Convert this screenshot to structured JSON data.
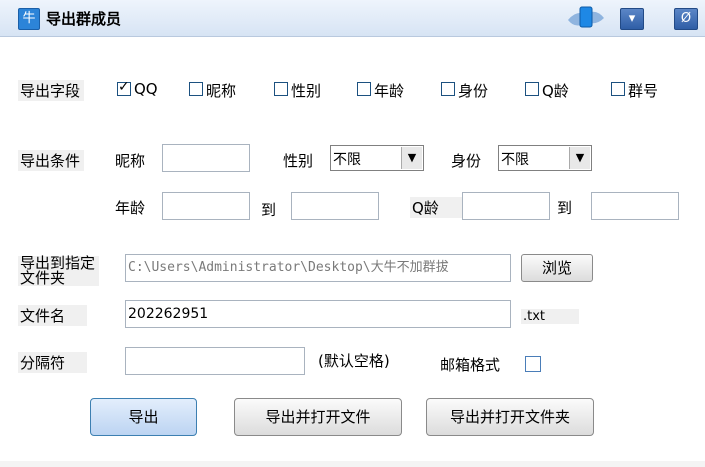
{
  "window": {
    "title": "导出群成员",
    "app_icon_glyph": "牛"
  },
  "titlebar_buttons": {
    "minimize_glyph": "▾",
    "close_glyph": "Ø"
  },
  "fields": {
    "label": "导出字段",
    "options": [
      {
        "label": "QQ",
        "checked": true
      },
      {
        "label": "昵称",
        "checked": false
      },
      {
        "label": "性别",
        "checked": false
      },
      {
        "label": "年龄",
        "checked": false
      },
      {
        "label": "身份",
        "checked": false
      },
      {
        "label": "Q龄",
        "checked": false
      },
      {
        "label": "群号",
        "checked": false
      }
    ]
  },
  "conditions": {
    "label": "导出条件",
    "nickname_label": "昵称",
    "nickname_value": "",
    "gender_label": "性别",
    "gender_value": "不限",
    "identity_label": "身份",
    "identity_value": "不限",
    "age_label": "年龄",
    "age_from": "",
    "age_to_label": "到",
    "age_to": "",
    "qage_label": "Q龄",
    "qage_from": "",
    "qage_to_label": "到",
    "qage_to": ""
  },
  "export": {
    "folder_label_line1": "导出到指定",
    "folder_label_line2": "文件夹",
    "folder_path": "C:\\Users\\Administrator\\Desktop\\大牛不加群拔",
    "browse_label": "浏览",
    "filename_label": "文件名",
    "filename_value": "202262951",
    "extension": ".txt",
    "separator_label": "分隔符",
    "separator_value": "",
    "separator_hint": "(默认空格)",
    "email_format_label": "邮箱格式",
    "email_format_checked": false
  },
  "buttons": {
    "export": "导出",
    "export_open_file": "导出并打开文件",
    "export_open_folder": "导出并打开文件夹"
  },
  "colors": {
    "title_bar": "#d7e4f4",
    "accent": "#2f5ea6",
    "primary_border": "#3c7fb1"
  }
}
